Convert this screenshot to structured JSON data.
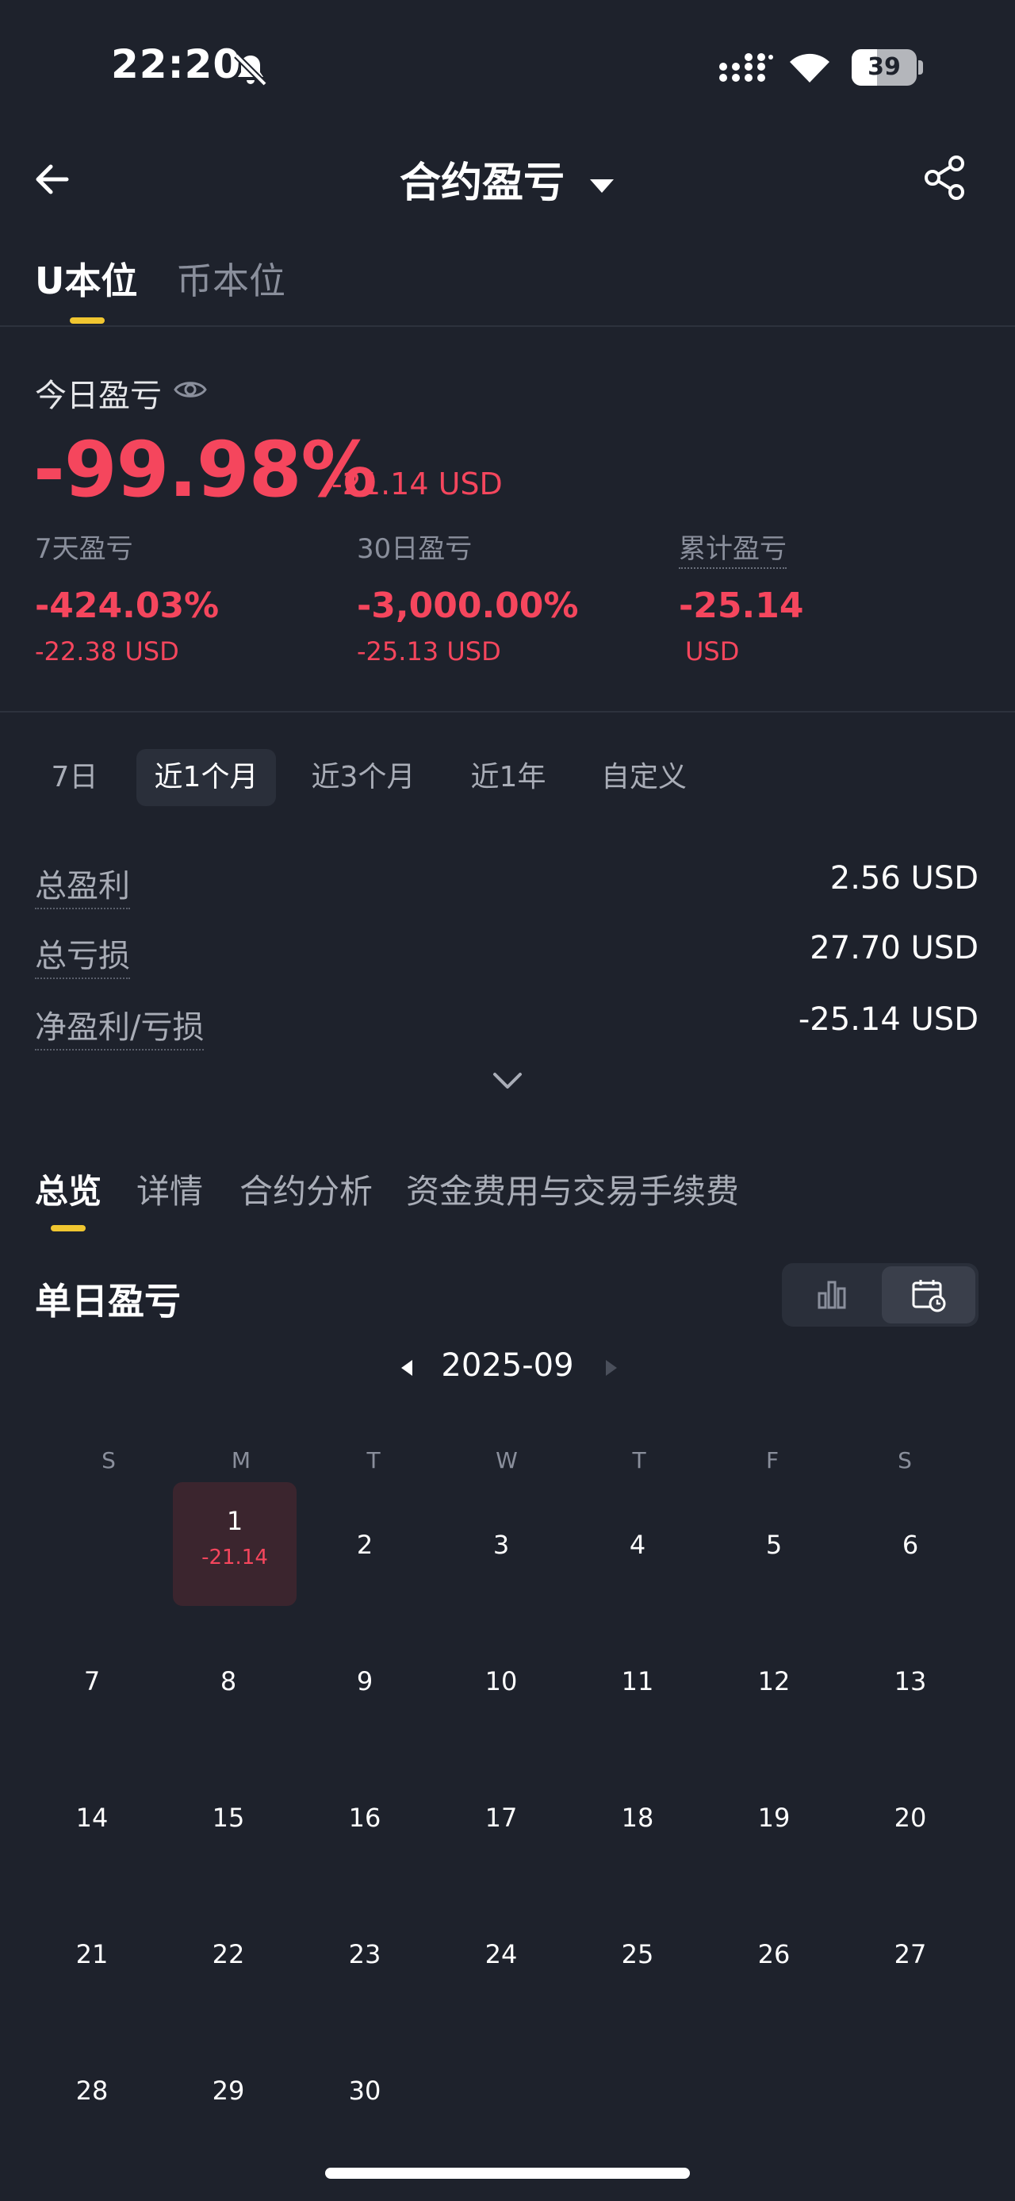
{
  "status_bar": {
    "time": "22:20",
    "battery": "39",
    "battery_level": 0.39,
    "icons": [
      "bell-off-icon",
      "signal-icon",
      "wifi-icon",
      "battery-icon"
    ]
  },
  "header": {
    "title": "合约盈亏",
    "icons": [
      "back-arrow-icon",
      "caret-down-icon",
      "share-icon"
    ]
  },
  "unit_tabs": [
    "U本位",
    "币本位"
  ],
  "today": {
    "label": "今日盈亏",
    "pct": "-99.98%",
    "usd": "-21.14 USD"
  },
  "stats": [
    {
      "label": "7天盈亏",
      "pct": "-424.03%",
      "usd": "-22.38 USD"
    },
    {
      "label": "30日盈亏",
      "pct": "-3,000.00%",
      "usd": "-25.13 USD"
    },
    {
      "label": "累计盈亏",
      "pct": "-25.14",
      "usd": "USD"
    }
  ],
  "period_tabs": [
    "7日",
    "近1个月",
    "近3个月",
    "近1年",
    "自定义"
  ],
  "period_selected": "近1个月",
  "summary": [
    {
      "label": "总盈利",
      "value": "2.56 USD"
    },
    {
      "label": "总亏损",
      "value": "27.70 USD"
    },
    {
      "label": "净盈利/亏损",
      "value": "-25.14 USD"
    }
  ],
  "section_tabs": [
    "总览",
    "详情",
    "合约分析",
    "资金费用与交易手续费"
  ],
  "daily": {
    "title": "单日盈亏",
    "month": "2025-09",
    "weekdays": [
      "S",
      "M",
      "T",
      "W",
      "T",
      "F",
      "S"
    ],
    "day1_pnl": "-21.14"
  },
  "colors": {
    "background": "#1e222c",
    "loss": "#f5465d",
    "accent": "#f0c630",
    "loss_cell": "#3b252e"
  }
}
